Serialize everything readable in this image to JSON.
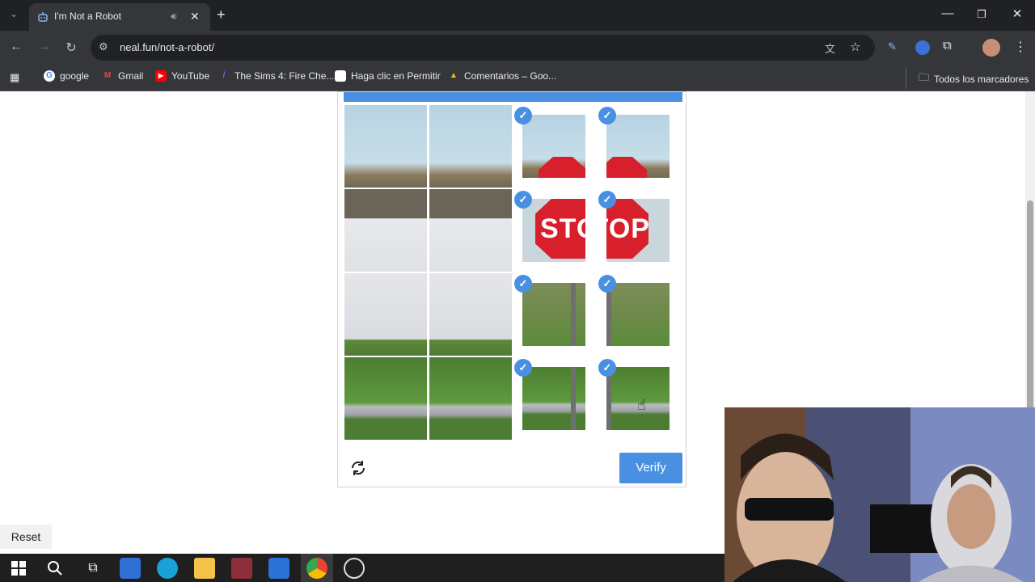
{
  "tab": {
    "title": "I'm Not a Robot"
  },
  "toolbar": {
    "url": "neal.fun/not-a-robot/"
  },
  "bookmarks": {
    "items": [
      {
        "label": "google"
      },
      {
        "label": "Gmail"
      },
      {
        "label": "YouTube"
      },
      {
        "label": "The Sims 4: Fire Che..."
      },
      {
        "label": "Haga clic en Permitir"
      },
      {
        "label": "Comentarios – Goo..."
      }
    ],
    "all_label": "Todos los marcadores"
  },
  "captcha": {
    "verify_label": "Verify",
    "stop_text": "STOP",
    "selected": [
      false,
      false,
      true,
      true,
      false,
      false,
      true,
      true,
      false,
      false,
      true,
      true,
      false,
      false,
      true,
      true
    ],
    "accent": "#4a90e2"
  },
  "page": {
    "reset_label": "Reset"
  }
}
